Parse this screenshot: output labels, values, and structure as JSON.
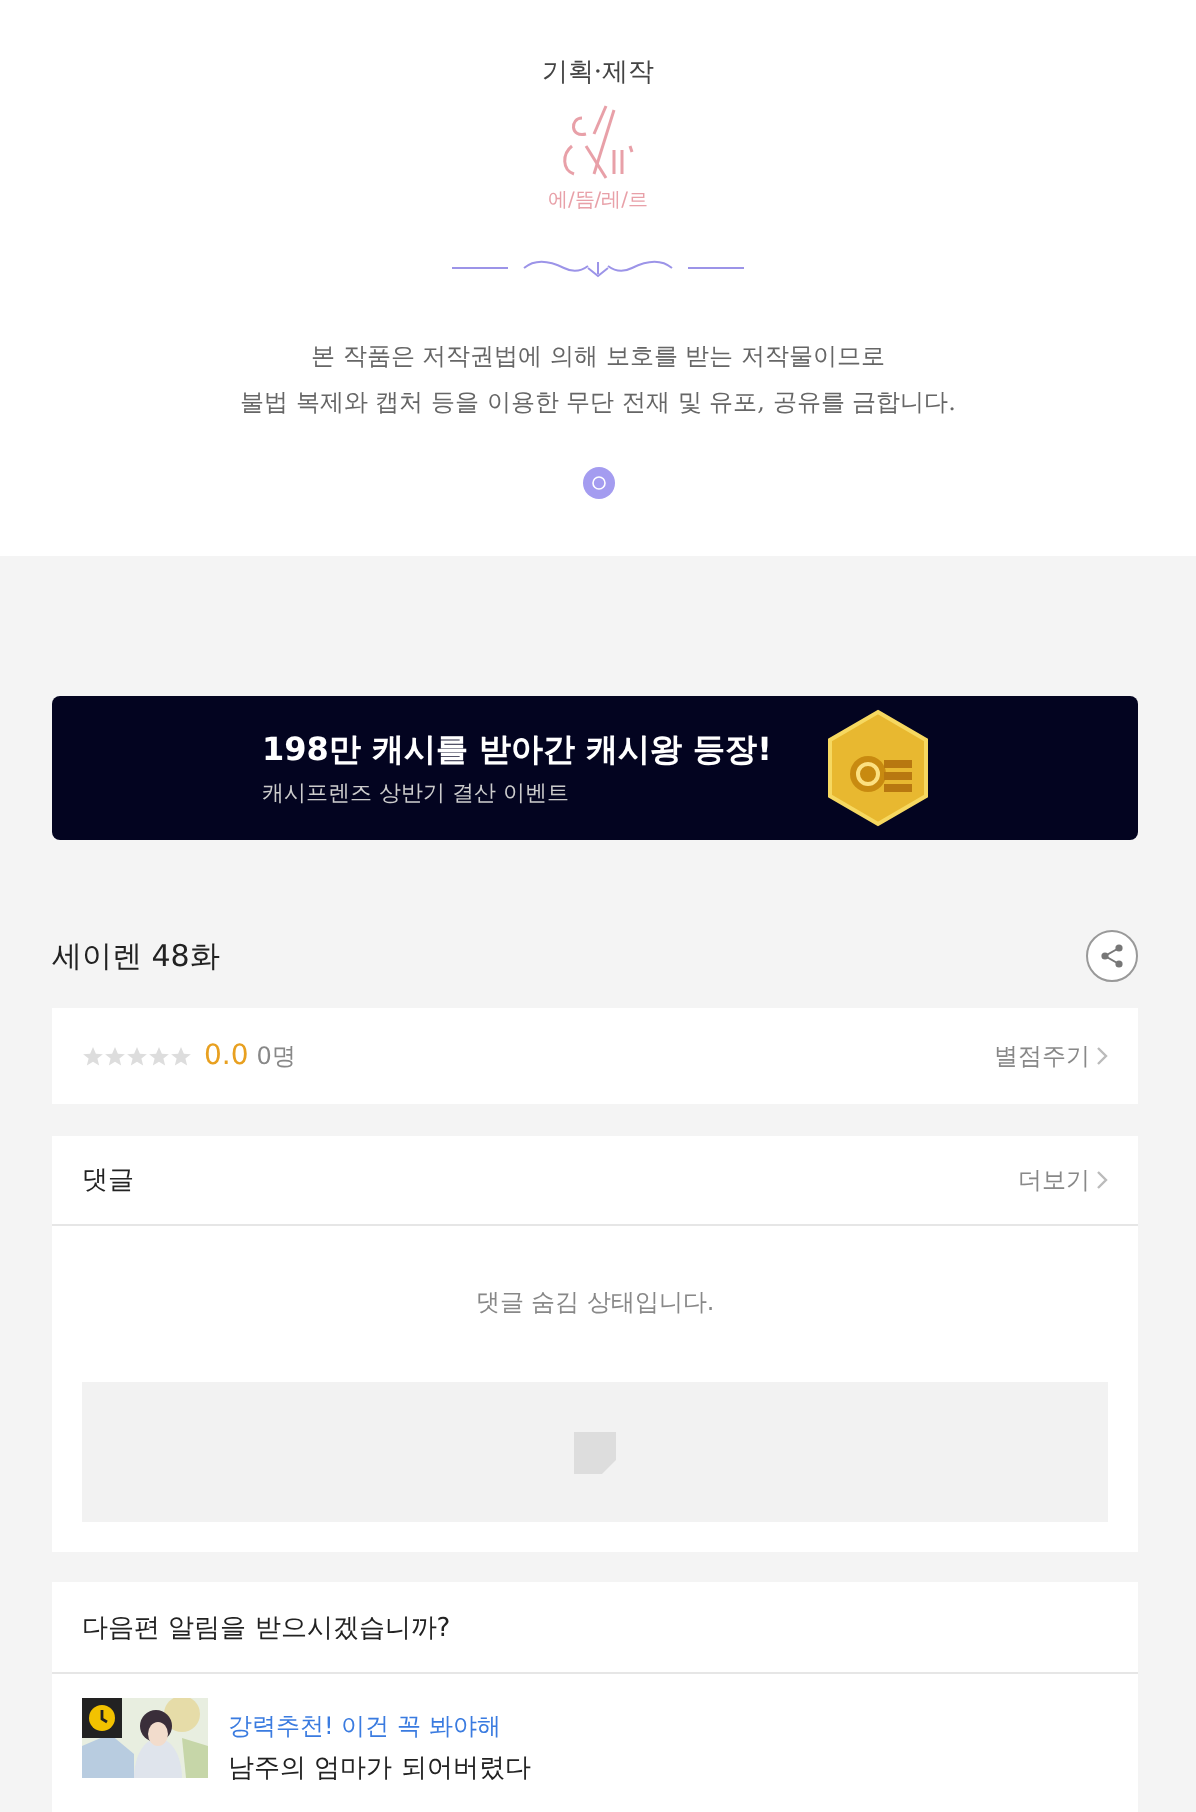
{
  "credits": {
    "label": "기획·제작",
    "logo_text": "에/뜸/레/르",
    "notice": [
      "본 작품은 저작권법에 의해 보호를 받는 저작물이므로",
      "불법 복제와 캡처 등을 이용한 무단 전재 및 유포, 공유를 금합니다."
    ]
  },
  "banner": {
    "headline": "198만 캐시를 받아간 캐시왕 등장!",
    "subline": "캐시프렌즈 상반기 결산 이벤트"
  },
  "episode": {
    "title": "세이렌 48화",
    "stars": 0,
    "score": "0.0",
    "count": "0명",
    "rate_button": "별점주기"
  },
  "comments": {
    "title": "댓글",
    "more": "더보기",
    "message": "댓글 숨김 상태입니다."
  },
  "next": {
    "question": "다음편 알림을 받으시겠습니까?",
    "items": [
      {
        "kind": "picture",
        "tag": "강력추천! 이건 꼭 봐야해",
        "title": "남주의 엄마가 되어버렸다"
      }
    ]
  }
}
